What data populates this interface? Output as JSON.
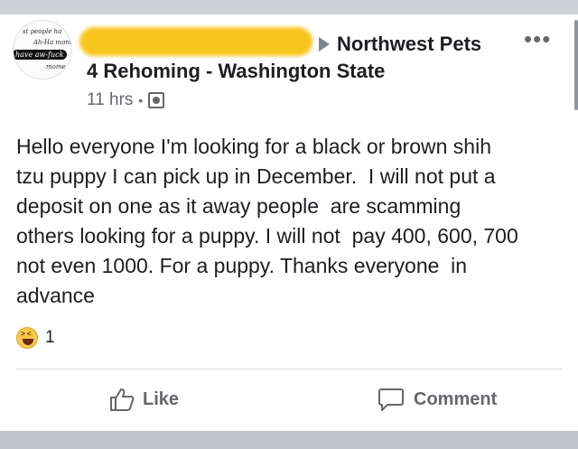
{
  "post": {
    "group_name_line1": "Northwest Pets",
    "group_name_line2": "4 Rehoming - Washington State",
    "time": "11 hrs",
    "separator": "•",
    "more": "•••",
    "avatar_text": [
      "st people ha",
      "Ah-Ha momen",
      "have aw-fuck",
      "mome"
    ],
    "body_lines": [
      "Hello everyone I'm looking for a black or brown shih",
      "tzu puppy I can pick up in December.  I will not put a",
      "deposit on one as it away people  are scamming",
      "others looking for a puppy. I will not  pay 400, 600, 700",
      "not even 1000. For a puppy. Thanks everyone  in",
      "advance"
    ],
    "reaction_count": "1"
  },
  "actions": {
    "like_label": "Like",
    "comment_label": "Comment"
  },
  "colors": {
    "redaction": "#f8c51c",
    "text": "#1c1e21",
    "secondary": "#65676b"
  },
  "icons": {
    "reaction": "haha-icon",
    "audience": "group-audience-icon",
    "like": "thumbs-up-icon",
    "comment": "comment-bubble-icon",
    "more": "more-icon",
    "arrow": "play-arrow-icon"
  }
}
